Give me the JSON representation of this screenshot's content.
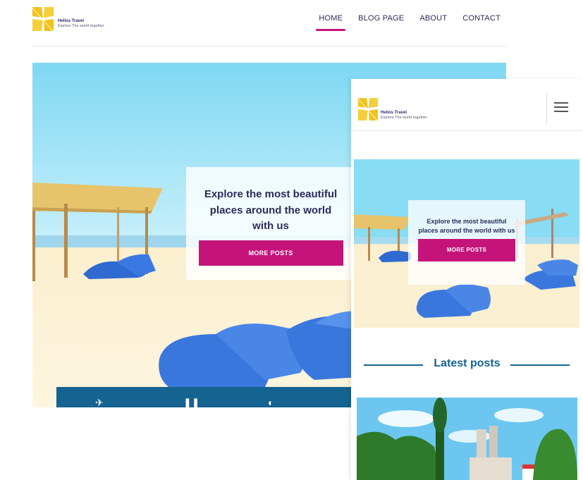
{
  "brand": {
    "name": "Helios Travel",
    "tagline": "Explore The world together",
    "accent_color": "#c4147a",
    "secondary_color": "#156391",
    "logo_color": "#f2c21b"
  },
  "desktop": {
    "nav": [
      {
        "label": "HOME",
        "active": true
      },
      {
        "label": "BLOG PAGE",
        "active": false
      },
      {
        "label": "ABOUT",
        "active": false
      },
      {
        "label": "CONTACT",
        "active": false
      }
    ],
    "hero": {
      "headline": "Explore the most beautiful places around the world with us",
      "button": "MORE POSTS"
    },
    "strip_icons": [
      "plane-icon",
      "pause-icon",
      "globe-icon"
    ]
  },
  "mobile": {
    "menu_icon": "hamburger-icon",
    "hero": {
      "headline": "Explore the most beautiful places around the world with us",
      "button": "MORE POSTS"
    },
    "latest_title": "Latest posts"
  }
}
